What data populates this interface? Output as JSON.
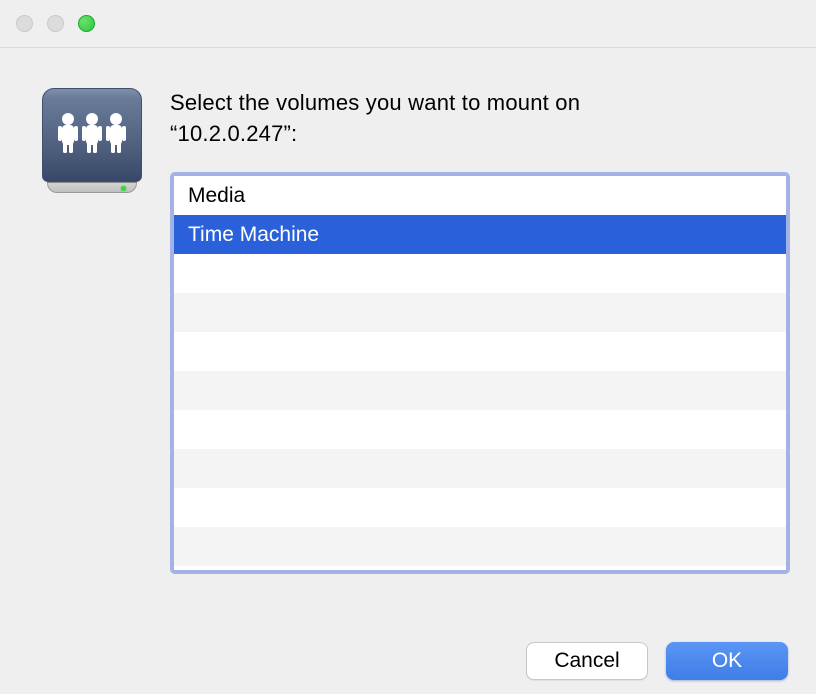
{
  "prompt": {
    "line1": "Select the volumes you want to mount on",
    "line2": "“10.2.0.247”:"
  },
  "volumes": [
    {
      "label": "Media",
      "selected": false
    },
    {
      "label": "Time Machine",
      "selected": true
    }
  ],
  "buttons": {
    "cancel": "Cancel",
    "ok": "OK"
  }
}
